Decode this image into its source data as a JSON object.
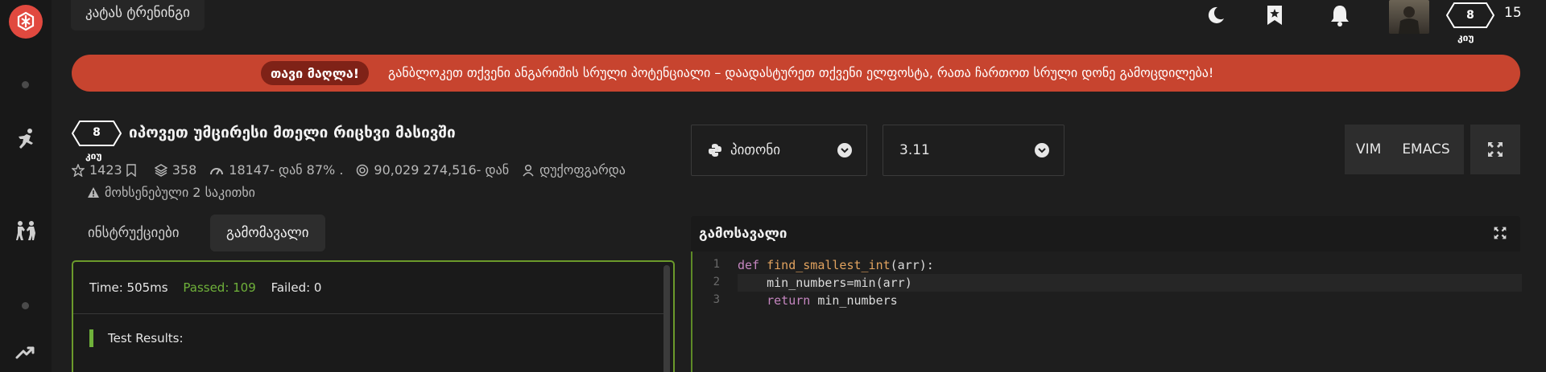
{
  "colors": {
    "background": "#1e1e1e",
    "brand": "#e1493f",
    "banner": "#c7442f",
    "passed": "#6fb13a"
  },
  "header": {
    "kata_training_label": "კატას ტრენინგი",
    "icons": [
      "moon-icon",
      "bookmark-star-icon",
      "bell-icon"
    ],
    "user": {
      "rank": "8",
      "rank_label": "კიუ",
      "honor": "15"
    }
  },
  "banner": {
    "pill": "თავი მაღლა!",
    "text": "განბლოკეთ თქვენი ანგარიშის სრული პოტენციალი – დაადასტურეთ თქვენი ელფოსტა, რათა ჩართოთ სრული დონე გამოცდილება!"
  },
  "kata": {
    "rank": "8",
    "rank_label": "კიუ",
    "title": "იპოვეთ უმცირესი მთელი რიცხვი მასივში",
    "stats": {
      "stars": "1423",
      "collections": "358",
      "completion": "18147- დან 87% .",
      "attempts": "90,029 274,516- დან",
      "author": "დუქოფგარდა"
    },
    "issues": "მოხსენებული 2 საკითხი"
  },
  "tabs": {
    "instructions": "ინსტრუქციები",
    "output": "გამომავალი"
  },
  "output": {
    "time": "Time: 505ms",
    "passed": "Passed: 109",
    "failed": "Failed: 0",
    "results_label": "Test Results:"
  },
  "editor_controls": {
    "language": "პითონი",
    "version": "3.11",
    "vim": "VIM",
    "emacs": "EMACS"
  },
  "solution": {
    "title": "გამოსავალი",
    "line_numbers": [
      "1",
      "2",
      "3"
    ],
    "lines": [
      {
        "kw": "def ",
        "fn": "find_smallest_int",
        "txt": "(arr):"
      },
      {
        "kw": "",
        "fn": "",
        "txt": "    min_numbers=min(arr)"
      },
      {
        "kw": "    return ",
        "fn": "",
        "txt": "min_numbers"
      }
    ]
  }
}
